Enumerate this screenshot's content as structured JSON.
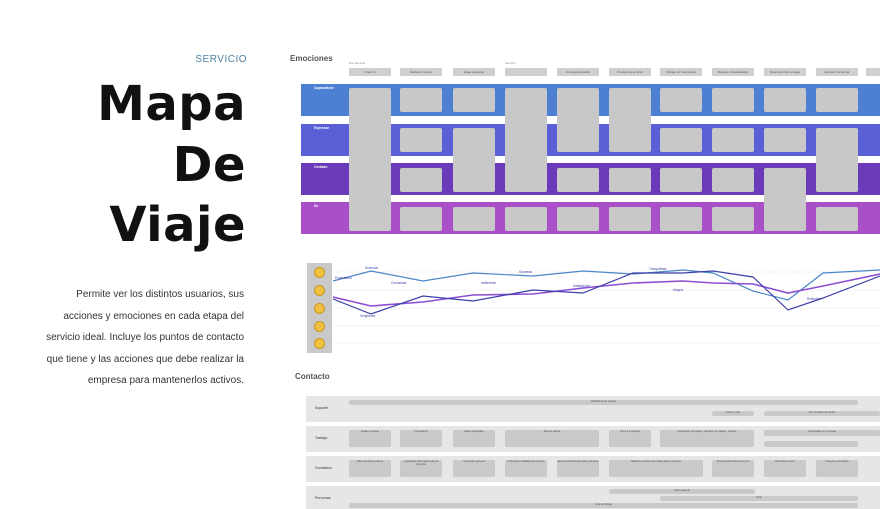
{
  "left": {
    "eyebrow": "SERVICIO",
    "title_lines": [
      "Mapa",
      "De",
      "Viaje"
    ],
    "description": "Permite ver los distintos usuarios, sus acciones y emociones en cada etapa del servicio ideal.  Incluye los puntos de contacto que tiene y las acciones que debe realizar la empresa para mantenerlos activos."
  },
  "map": {
    "emociones_label": "Emociones",
    "contacto_label": "Contacto",
    "pre_servicio_label": "Pre Servicio",
    "servicio_label": "Servicio",
    "phases": [
      "Crear tu",
      "Reflexión previo",
      "Haga impuesta",
      "",
      "Una aproximación",
      "Proceso de emisión",
      "Trabajo en movimiento",
      "Revisar entrada/salida",
      "Después Post entrega",
      "Revisión Ficha Agr",
      ""
    ],
    "bands": [
      {
        "label": "Capacitarse",
        "color": "#4d7fd2"
      },
      {
        "label": "Expresar",
        "color": "#5a5fd6"
      },
      {
        "label": "Cortado",
        "color": "#6a3ab8"
      },
      {
        "label": "Se",
        "color": "#a94fc8"
      }
    ],
    "contact_rows": [
      "Soporte",
      "Trabajo",
      "Contables",
      "Personas"
    ],
    "contact_boxes": [
      {
        "row": 0,
        "text": "Plataforma por Gastos"
      },
      {
        "row": 0,
        "text": "Gasto y flujo"
      },
      {
        "row": 0,
        "text": "Sin consultas de ofertas"
      },
      {
        "row": 1,
        "text": "Cuadro de ideas"
      },
      {
        "row": 1,
        "text": "Formularios"
      },
      {
        "row": 1,
        "text": "Bases de llegada"
      },
      {
        "row": 1,
        "text": "Días de oficina"
      },
      {
        "row": 1,
        "text": "Aviso a empresas"
      },
      {
        "row": 1,
        "text": "Parámetros de trabajo - Revisión de trabajo - Análisis"
      },
      {
        "row": 1,
        "text": "Formularios por mensaje"
      },
      {
        "row": 2,
        "text": "Web consultora externa"
      },
      {
        "row": 2,
        "text": "Llegada de información para el proyecto"
      },
      {
        "row": 2,
        "text": "Formulario general"
      },
      {
        "row": 2,
        "text": "Información detallada del servicio"
      },
      {
        "row": 2,
        "text": "Bases de información para el proceso"
      },
      {
        "row": 2,
        "text": "Salida de revisión del trabajo para el proceso"
      },
      {
        "row": 2,
        "text": "Revisar Información de envío"
      },
      {
        "row": 2,
        "text": "Información envío"
      },
      {
        "row": 2,
        "text": "Proyectos vinculados"
      },
      {
        "row": 3,
        "text": "Algún aspecto"
      },
      {
        "row": 3,
        "text": "Final"
      },
      {
        "row": 3,
        "text": "Área de trabajo"
      }
    ],
    "emotion_labels": [
      "Expectativa",
      "Diversión",
      "Curiosidad",
      "Indiferente",
      "Vergüenza",
      "Sorpresa",
      "Satisfacción",
      "Tranquilidad",
      "Alegría",
      "Reflexión"
    ],
    "colors": {
      "line1": "#4a86c8",
      "line2": "#8c4fd0",
      "line3": "#3b3fa8",
      "accent": "#4a7fa0"
    }
  }
}
